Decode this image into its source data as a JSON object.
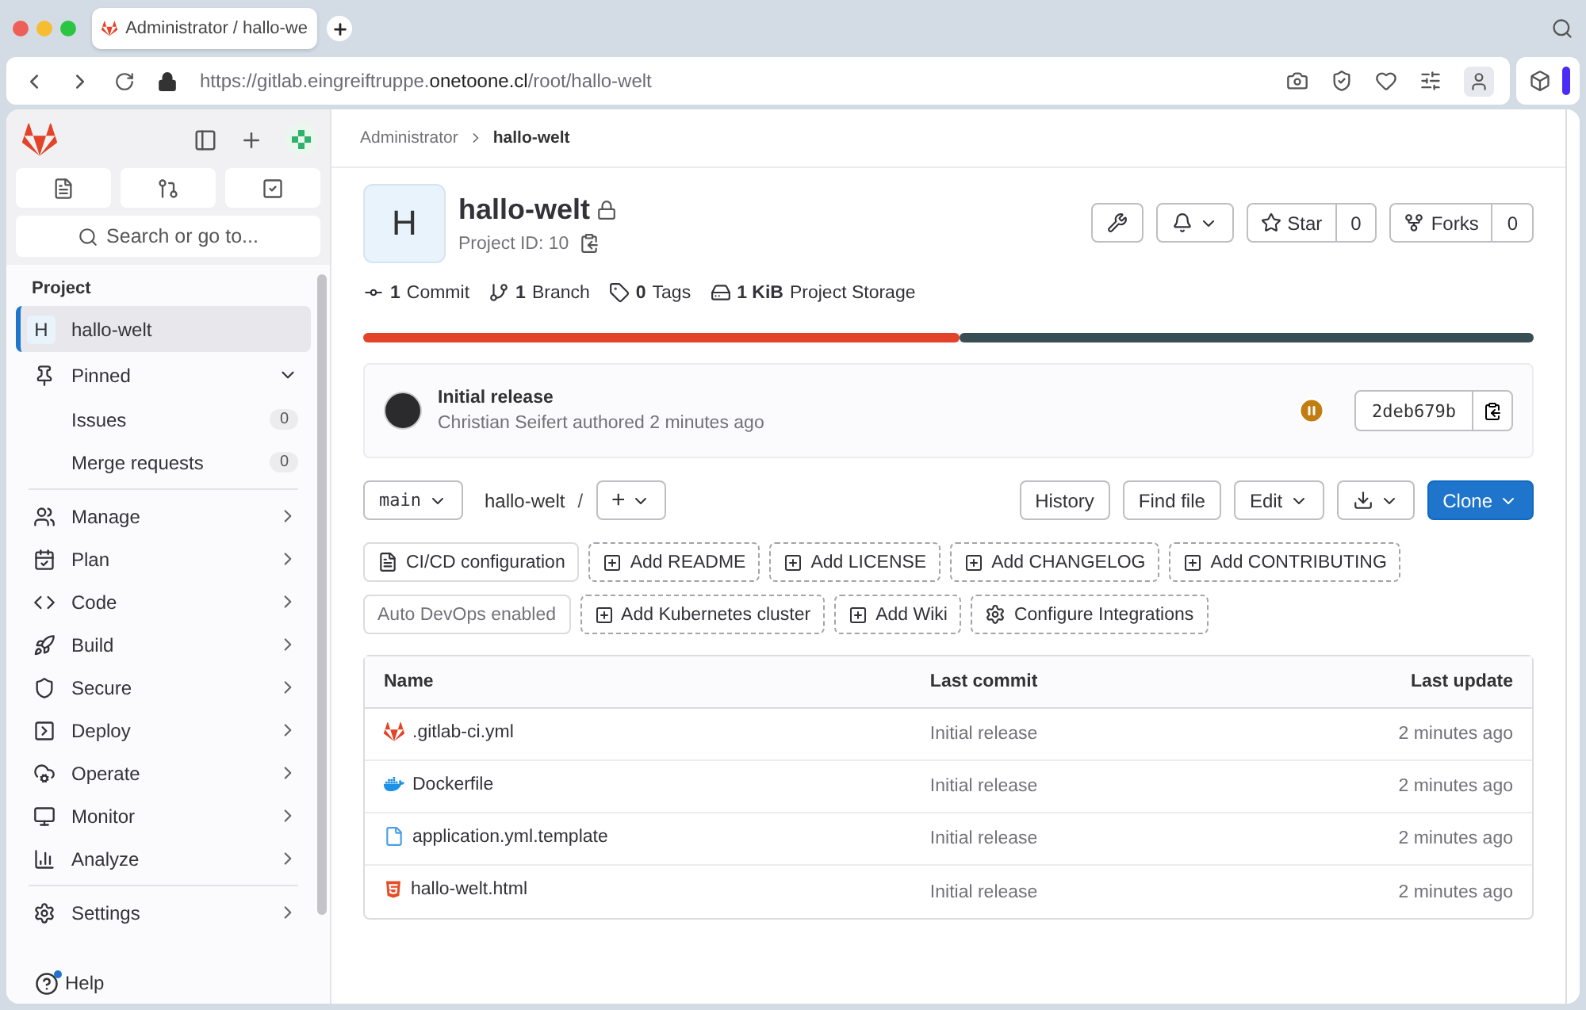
{
  "browser": {
    "tab": {
      "title": "Administrator / hallo-we",
      "selected": true
    },
    "url": {
      "prefix": "https://gitlab.eingreiftruppe.",
      "domain": "onetoone.cl",
      "path": "/root/hallo-welt"
    }
  },
  "sidebar": {
    "search": {
      "placeholder": "Search or go to..."
    },
    "section": "Project",
    "project": {
      "initial": "H",
      "name": "hallo-welt",
      "selected": true
    },
    "pinned": {
      "label": "Pinned",
      "expanded": true,
      "items": [
        {
          "label": "Issues",
          "count": "0"
        },
        {
          "label": "Merge requests",
          "count": "0"
        }
      ]
    },
    "nav": [
      {
        "kind": "manage",
        "label": "Manage"
      },
      {
        "kind": "plan",
        "label": "Plan"
      },
      {
        "kind": "code",
        "label": "Code"
      },
      {
        "kind": "build",
        "label": "Build"
      },
      {
        "kind": "secure",
        "label": "Secure"
      },
      {
        "kind": "deploy",
        "label": "Deploy"
      },
      {
        "kind": "operate",
        "label": "Operate"
      },
      {
        "kind": "monitor",
        "label": "Monitor"
      },
      {
        "kind": "analyze",
        "label": "Analyze"
      },
      {
        "kind": "settings",
        "label": "Settings"
      }
    ],
    "help": {
      "label": "Help",
      "unread": true
    }
  },
  "breadcrumbs": [
    {
      "label": "Administrator",
      "current": false
    },
    {
      "label": "hallo-welt",
      "current": true
    }
  ],
  "project": {
    "initial": "H",
    "name": "hallo-welt",
    "private": true,
    "id_label": "Project ID: 10",
    "star": {
      "label": "Star",
      "count": "0"
    },
    "forks": {
      "label": "Forks",
      "count": "0"
    }
  },
  "stats": [
    {
      "kind": "commit",
      "count": "1",
      "label": "Commit"
    },
    {
      "kind": "branch",
      "count": "1",
      "label": "Branch"
    },
    {
      "kind": "tag",
      "count": "0",
      "label": "Tags"
    },
    {
      "kind": "storage",
      "count": "1 KiB",
      "label": "Project Storage"
    }
  ],
  "languages": [
    {
      "color": "#e24329",
      "level": 0.51
    },
    {
      "color": "#384d54",
      "level": 0.49
    }
  ],
  "last_commit": {
    "title": "Initial release",
    "meta": "Christian Seifert authored 2 minutes ago",
    "pipeline": {
      "kind": "paused"
    },
    "sha": "2deb679b"
  },
  "repo_toolbar": {
    "branch": "main",
    "path": "hallo-welt",
    "separator": "/",
    "add_label": "+",
    "buttons": [
      {
        "kind": "text",
        "label": "History"
      },
      {
        "kind": "text",
        "label": "Find file"
      },
      {
        "kind": "dropdown",
        "label": "Edit"
      },
      {
        "kind": "download"
      },
      {
        "kind": "primary",
        "label": "Clone"
      }
    ]
  },
  "shortcuts": [
    [
      {
        "kind": "config",
        "label": "CI/CD configuration"
      },
      {
        "kind": "add",
        "label": "Add README"
      },
      {
        "kind": "add",
        "label": "Add LICENSE"
      },
      {
        "kind": "add",
        "label": "Add CHANGELOG"
      },
      {
        "kind": "add",
        "label": "Add CONTRIBUTING"
      }
    ],
    [
      {
        "kind": "status",
        "label": "Auto DevOps enabled"
      },
      {
        "kind": "add",
        "label": "Add Kubernetes cluster"
      },
      {
        "kind": "add",
        "label": "Add Wiki"
      },
      {
        "kind": "integrations",
        "label": "Configure Integrations"
      }
    ]
  ],
  "files": {
    "columns": [
      "Name",
      "Last commit",
      "Last update"
    ],
    "rows": [
      {
        "kind": "gitlab",
        "name": ".gitlab-ci.yml",
        "commit": "Initial release",
        "updated": "2 minutes ago"
      },
      {
        "kind": "docker",
        "name": "Dockerfile",
        "commit": "Initial release",
        "updated": "2 minutes ago"
      },
      {
        "kind": "file",
        "name": "application.yml.template",
        "commit": "Initial release",
        "updated": "2 minutes ago"
      },
      {
        "kind": "html",
        "name": "hallo-welt.html",
        "commit": "Initial release",
        "updated": "2 minutes ago"
      }
    ]
  }
}
